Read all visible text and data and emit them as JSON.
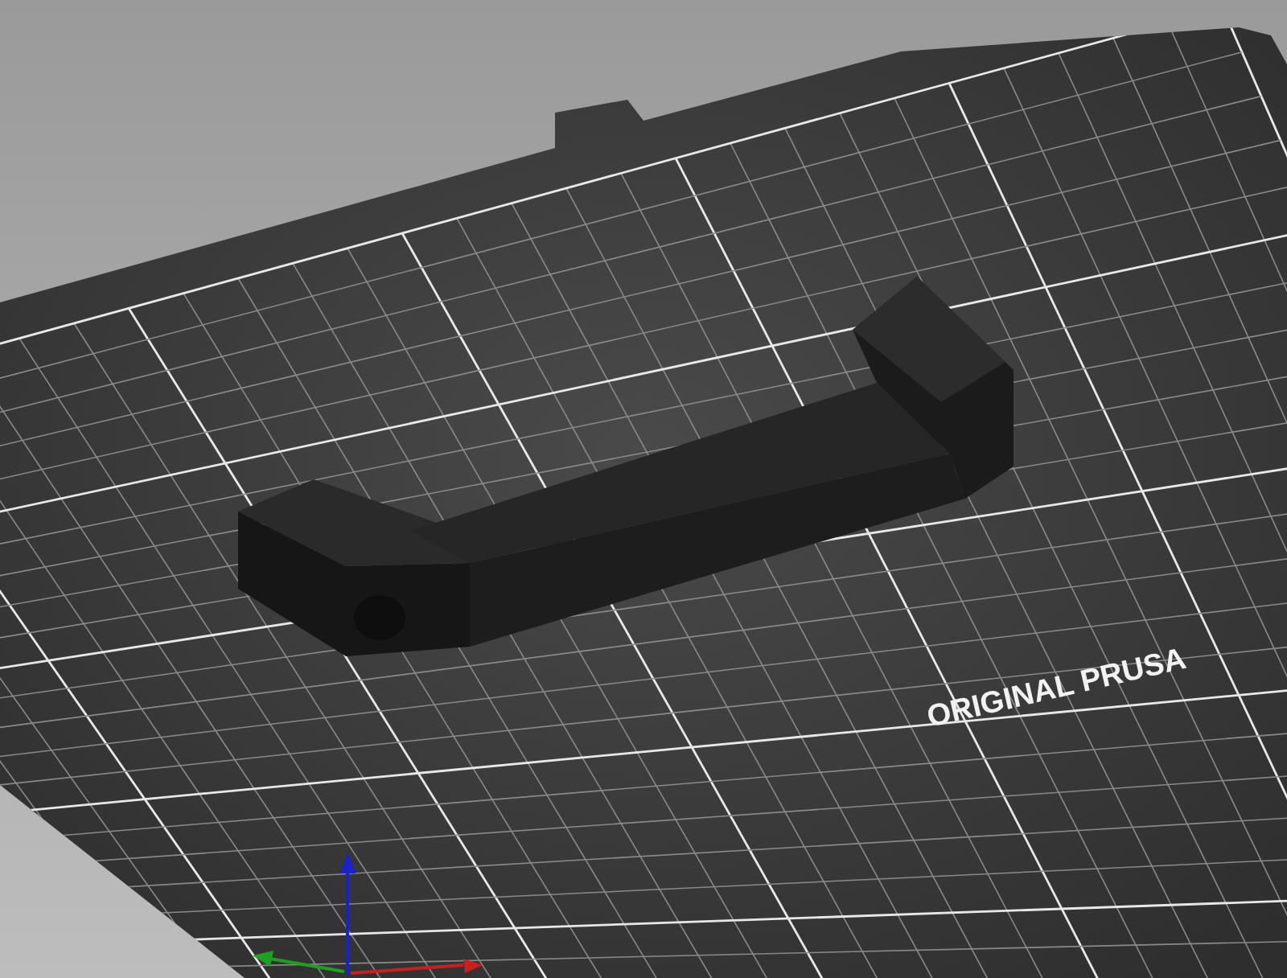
{
  "viewport": {
    "bed_label": "ORIGINAL PRUSA"
  }
}
